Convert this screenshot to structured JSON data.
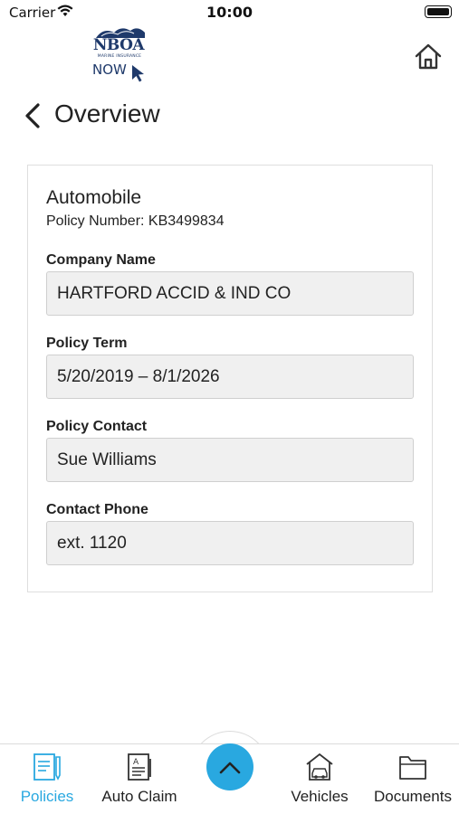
{
  "status_bar": {
    "carrier": "Carrier",
    "time": "10:00"
  },
  "logo": {
    "brand": "NBOA",
    "tagline": "MARINE INSURANCE",
    "now": "NOW"
  },
  "header": {
    "title": "Overview"
  },
  "policy": {
    "type": "Automobile",
    "number_text": "Policy Number: KB3499834",
    "fields": [
      {
        "label": "Company Name",
        "value": "HARTFORD ACCID & IND CO"
      },
      {
        "label": "Policy Term",
        "value": "5/20/2019 – 8/1/2026"
      },
      {
        "label": "Policy Contact",
        "value": "Sue Williams"
      },
      {
        "label": "Contact Phone",
        "value": "ext. 1120"
      }
    ]
  },
  "tab_bar": {
    "tabs": [
      {
        "label": "Policies",
        "icon": "policies-icon",
        "active": true
      },
      {
        "label": "Auto Claim",
        "icon": "auto-claim-icon",
        "active": false
      },
      {
        "label": "Vehicles",
        "icon": "vehicles-icon",
        "active": false
      },
      {
        "label": "Documents",
        "icon": "documents-icon",
        "active": false
      }
    ],
    "center_button_icon": "chevron-up-icon"
  },
  "colors": {
    "accent": "#29a8e0",
    "brand": "#1f3a6b",
    "field_bg": "#f0f0f0"
  }
}
